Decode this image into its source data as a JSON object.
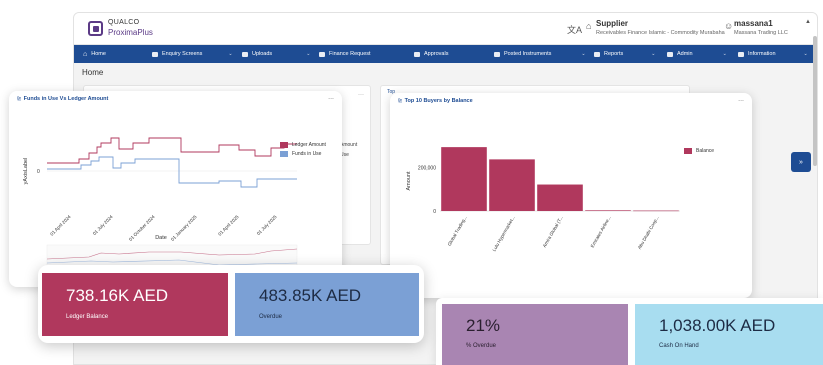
{
  "app": {
    "logo_line1": "QUALCO",
    "logo_line2": "ProximaPlus",
    "role_label": "Supplier",
    "role_sub": "Receivables Finance Islamic - Commodity Murabaha",
    "user_name": "massana1",
    "user_org": "Massana Trading LLC"
  },
  "nav": {
    "items": [
      {
        "label": "Home"
      },
      {
        "label": "Enquiry Screens"
      },
      {
        "label": "Uploads"
      },
      {
        "label": "Finance Request"
      },
      {
        "label": "Approvals"
      },
      {
        "label": "Posted Instruments"
      },
      {
        "label": "Reports"
      },
      {
        "label": "Admin"
      },
      {
        "label": "Information"
      }
    ]
  },
  "breadcrumb": "Home",
  "background_panels": {
    "right_title": "Top",
    "peek_line1": "Amount",
    "peek_line2": "Use"
  },
  "side_tab_label": "»",
  "funds_chart": {
    "title": "Funds in Use Vs Ledger Amount",
    "menu": "...",
    "chart_data": {
      "type": "line",
      "title": "Funds in Use Vs Ledger Amount",
      "xlabel": "Date",
      "ylabel": "yAxisLabel",
      "y_ticks": [
        "0"
      ],
      "x_ticks": [
        "01 April 2024",
        "01 July 2024",
        "01 October 2024",
        "01 January 2025",
        "01 April 2025",
        "01 July 2025"
      ],
      "series": [
        {
          "name": "Ledger Amount",
          "color": "#b0385d"
        },
        {
          "name": "Funds in Use",
          "color": "#7ba0d5"
        }
      ],
      "legend": "right"
    }
  },
  "buyers_chart": {
    "title": "Top 10 Buyers by Balance",
    "menu": "...",
    "chart_data": {
      "type": "bar",
      "title": "Top 10 Buyers by Balance",
      "xlabel": "",
      "ylabel": "Amount",
      "categories": [
        "Global Trading...",
        "Lulu Hypermarket...",
        "Amira Global (T...",
        "Emirates Airline...",
        "Abu Dhabi Coop..."
      ],
      "series": [
        {
          "name": "Balance",
          "values": [
            292000,
            236000,
            121000,
            3000,
            2000
          ]
        }
      ],
      "y_ticks": [
        "0",
        "200,000"
      ],
      "ylim": [
        0,
        320000
      ],
      "legend": "top-right",
      "color": "#b0385d"
    }
  },
  "kpis": {
    "ledger": {
      "value": "738.16K AED",
      "label": "Ledger Balance"
    },
    "overdue": {
      "value": "483.85K AED",
      "label": "Overdue"
    },
    "pct_overdue": {
      "value": "21%",
      "label": "% Overdue"
    },
    "cash": {
      "value": "1,038.00K AED",
      "label": "Cash On Hand"
    }
  },
  "colors": {
    "brand_purple": "#5b3a86",
    "nav_blue": "#1e4c93",
    "ledger": "#b0385d",
    "funds": "#7ba0d5",
    "pct": "#a985b2",
    "cash": "#a8ddf0"
  }
}
